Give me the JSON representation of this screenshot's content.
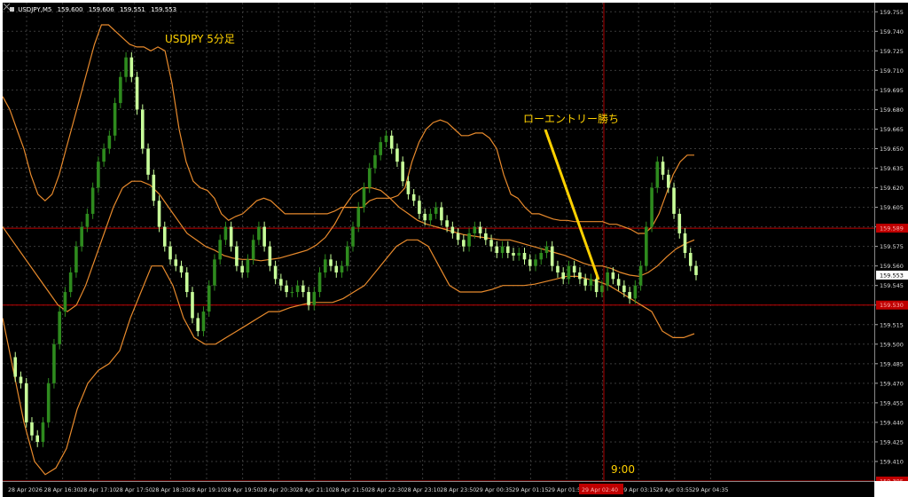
{
  "header": {
    "symbol": "USDJPY,M5",
    "ohlc": [
      "159.600",
      "159.606",
      "159.551",
      "159.553"
    ]
  },
  "annotations": {
    "title": "USDJPY 5分足",
    "entry_label": "ローエントリー勝ち",
    "time_label": "9:00"
  },
  "price_axis": {
    "labels": [
      "159.755",
      "159.740",
      "159.725",
      "159.710",
      "159.695",
      "159.680",
      "159.665",
      "159.650",
      "159.635",
      "159.620",
      "159.605",
      "159.590",
      "159.575",
      "159.560",
      "159.545",
      "159.530",
      "159.515",
      "159.500",
      "159.485",
      "159.470",
      "159.455",
      "159.440",
      "159.425",
      "159.410"
    ],
    "current_price": "159.553",
    "red_line_upper": "159.589",
    "red_line_lower": "159.530",
    "red_line_bottom": "159.395"
  },
  "time_axis": {
    "labels": [
      "28 Apr 2026",
      "28 Apr 16:30",
      "28 Apr 17:10",
      "28 Apr 17:50",
      "28 Apr 18:30",
      "28 Apr 19:10",
      "28 Apr 19:50",
      "28 Apr 20:30",
      "28 Apr 21:10",
      "28 Apr 21:50",
      "28 Apr 22:30",
      "28 Apr 23:10",
      "28 Apr 23:50",
      "29 Apr 00:35",
      "29 Apr 01:15",
      "29 Apr 01:55",
      "29 Apr 02:35",
      "29 Apr 03:15",
      "29 Apr 03:55",
      "29 Apr 04:35"
    ],
    "highlight_label": "29 Apr 02:40"
  },
  "colors": {
    "background": "#000000",
    "grid": "#3a3a3a",
    "candle_bull": "#2e8b1e",
    "candle_bear": "#c8ff9a",
    "bands": "#e88a2c",
    "annotation": "#ffd100",
    "red_line": "#c00000",
    "crosshair": "#b00000"
  },
  "chart_data": {
    "type": "candlestick",
    "series": [
      {
        "name": "price",
        "values": [
          159.49,
          159.475,
          159.47,
          159.44,
          159.43,
          159.425,
          159.44,
          159.47,
          159.5,
          159.525,
          159.54,
          159.555,
          159.575,
          159.59,
          159.6,
          159.62,
          159.64,
          159.65,
          159.66,
          159.685,
          159.705,
          159.72,
          159.705,
          159.68,
          159.65,
          159.63,
          159.61,
          159.59,
          159.575,
          159.565,
          159.56,
          159.555,
          159.54,
          159.52,
          159.51,
          159.525,
          159.545,
          159.565,
          159.58,
          159.59,
          159.575,
          159.56,
          159.555,
          159.565,
          159.58,
          159.59,
          159.575,
          159.56,
          159.55,
          159.545,
          159.54,
          159.54,
          159.545,
          159.54,
          159.53,
          159.54,
          159.555,
          159.565,
          159.56,
          159.555,
          159.56,
          159.575,
          159.59,
          159.605,
          159.62,
          159.635,
          159.645,
          159.655,
          159.66,
          159.65,
          159.64,
          159.625,
          159.615,
          159.61,
          159.6,
          159.595,
          159.6,
          159.605,
          159.595,
          159.59,
          159.585,
          159.58,
          159.575,
          159.585,
          159.59,
          159.585,
          159.58,
          159.575,
          159.57,
          159.575,
          159.57,
          159.568,
          159.57,
          159.565,
          159.56,
          159.565,
          159.57,
          159.575,
          159.56,
          159.555,
          159.55,
          159.56,
          159.555,
          159.55,
          159.545,
          159.55,
          159.54,
          159.545,
          159.555,
          159.55,
          159.545,
          159.54,
          159.535,
          159.545,
          159.56,
          159.59,
          159.62,
          159.64,
          159.63,
          159.62,
          159.6,
          159.585,
          159.57,
          159.56,
          159.553
        ]
      },
      {
        "name": "upper",
        "values": [
          159.69,
          159.68,
          159.665,
          159.65,
          159.63,
          159.615,
          159.61,
          159.615,
          159.63,
          159.65,
          159.67,
          159.69,
          159.71,
          159.73,
          159.745,
          159.745,
          159.74,
          159.735,
          159.73,
          159.728,
          159.728,
          159.725,
          159.728,
          159.725,
          159.7,
          159.665,
          159.64,
          159.625,
          159.62,
          159.618,
          159.612,
          159.6,
          159.595,
          159.598,
          159.6,
          159.605,
          159.61,
          159.612,
          159.61,
          159.605,
          159.6,
          159.6,
          159.6,
          159.6,
          159.6,
          159.6,
          159.6,
          159.602,
          159.605,
          159.605,
          159.605,
          159.605,
          159.61,
          159.612,
          159.612,
          159.612,
          159.614,
          159.62,
          159.64,
          159.655,
          159.665,
          159.67,
          159.672,
          159.67,
          159.665,
          159.66,
          159.66,
          159.662,
          159.662,
          159.658,
          159.65,
          159.63,
          159.615,
          159.612,
          159.605,
          159.6,
          159.6,
          159.598,
          159.596,
          159.595,
          159.595,
          159.594,
          159.594,
          159.594,
          159.594,
          159.594,
          159.592,
          159.592,
          159.59,
          159.588,
          159.585,
          159.585,
          159.59,
          159.6,
          159.615,
          159.63,
          159.64,
          159.645,
          159.645
        ]
      },
      {
        "name": "middle",
        "values": [
          159.59,
          159.58,
          159.57,
          159.56,
          159.55,
          159.54,
          159.53,
          159.525,
          159.53,
          159.545,
          159.565,
          159.585,
          159.605,
          159.62,
          159.625,
          159.625,
          159.622,
          159.615,
          159.605,
          159.595,
          159.585,
          159.58,
          159.575,
          159.572,
          159.568,
          159.566,
          159.565,
          159.565,
          159.564,
          159.565,
          159.566,
          159.568,
          159.57,
          159.572,
          159.576,
          159.582,
          159.592,
          159.605,
          159.615,
          159.62,
          159.62,
          159.618,
          159.612,
          159.605,
          159.6,
          159.595,
          159.592,
          159.59,
          159.588,
          159.586,
          159.584,
          159.583,
          159.582,
          159.581,
          159.58,
          159.58,
          159.578,
          159.576,
          159.574,
          159.572,
          159.57,
          159.568,
          159.565,
          159.562,
          159.56,
          159.56,
          159.558,
          159.555,
          159.553,
          159.552,
          159.555,
          159.56,
          159.567,
          159.573,
          159.577,
          159.58
        ]
      },
      {
        "name": "lower",
        "values": [
          159.52,
          159.48,
          159.44,
          159.41,
          159.4,
          159.405,
          159.42,
          159.45,
          159.47,
          159.48,
          159.485,
          159.495,
          159.52,
          159.54,
          159.56,
          159.56,
          159.545,
          159.52,
          159.505,
          159.5,
          159.5,
          159.505,
          159.51,
          159.515,
          159.52,
          159.525,
          159.525,
          159.528,
          159.53,
          159.532,
          159.532,
          159.532,
          159.535,
          159.54,
          159.545,
          159.555,
          159.565,
          159.575,
          159.58,
          159.58,
          159.575,
          159.56,
          159.545,
          159.54,
          159.54,
          159.54,
          159.542,
          159.545,
          159.545,
          159.545,
          159.546,
          159.548,
          159.55,
          159.552,
          159.552,
          159.55,
          159.548,
          159.545,
          159.54,
          159.535,
          159.53,
          159.525,
          159.51,
          159.505,
          159.505,
          159.508
        ]
      }
    ],
    "y_range": [
      159.395,
      159.762
    ],
    "grid": true
  }
}
